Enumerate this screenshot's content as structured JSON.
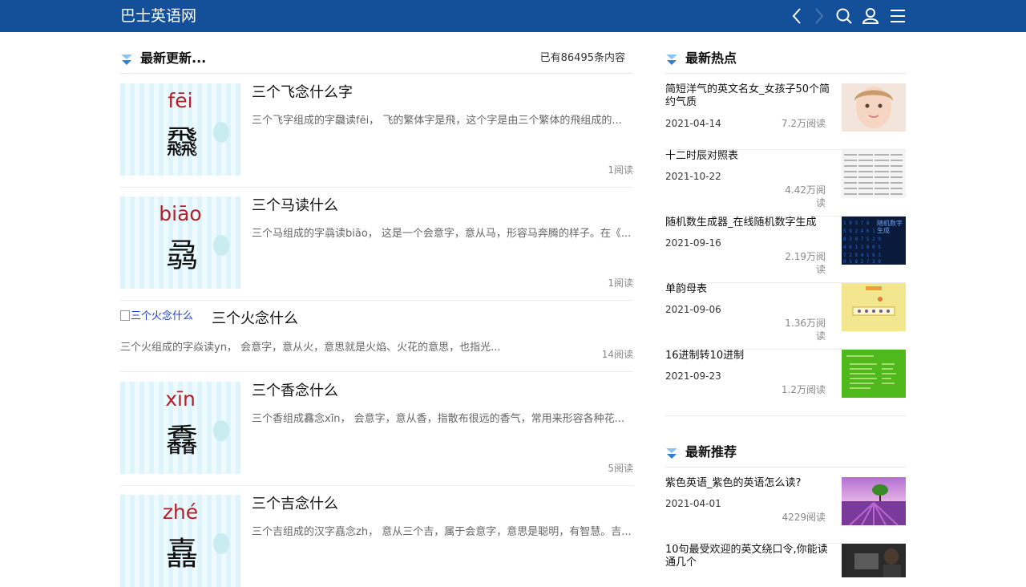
{
  "header": {
    "logo": "巴士英语网",
    "icons": [
      "chevron-left-icon",
      "chevron-right-icon",
      "search-icon",
      "user-icon",
      "menu-icon"
    ],
    "bg_color": "#14509a"
  },
  "latest": {
    "title": "最新更新...",
    "count": "已有86495条内容",
    "articles": [
      {
        "title": "三个飞念什么字",
        "desc": "三个飞字组成的字飝读fēi， 飞的繁体字是飛，这个字是由三个繁体的飛组成的...",
        "reads": "1阅读",
        "pinyin": "fēi",
        "glyph": "飝"
      },
      {
        "title": "三个马读什么",
        "desc": "三个马组成的字骉读biāo， 这是一个会意字，意从马，形容马奔腾的样子。在《...",
        "reads": "1阅读",
        "pinyin": "biāo",
        "glyph": "骉"
      },
      {
        "title": "三个火念什么",
        "desc": "三个火组成的字焱读yn， 会意字，意从火，意思就是火焰、火花的意思，也指光...",
        "reads": "14阅读",
        "alt": "三个火念什么"
      },
      {
        "title": "三个香念什么",
        "desc": "三个香组成馫念xīn， 会意字，意从香，指散布很远的香气，常用来形容各种花...",
        "reads": "5阅读",
        "pinyin": "xīn",
        "glyph": "馫"
      },
      {
        "title": "三个吉念什么",
        "desc": "三个吉组成的汉字嚞念zh， 意从三个吉，属于会意字，意思是聪明，有智慧。吉...",
        "reads": "",
        "pinyin": "zhé",
        "glyph": "嚞"
      }
    ]
  },
  "hot": {
    "title": "最新热点",
    "items": [
      {
        "title": "简短洋气的英文名女_女孩子50个简约气质",
        "date": "2021-04-14",
        "reads": "7.2万阅读"
      },
      {
        "title": "十二时辰对照表",
        "date": "2021-10-22",
        "reads": "4.42万阅读"
      },
      {
        "title": "随机数生成器_在线随机数字生成",
        "date": "2021-09-16",
        "reads": "2.19万阅读",
        "img_text": "随机数字\n生成"
      },
      {
        "title": "单韵母表",
        "date": "2021-09-06",
        "reads": "1.36万阅读"
      },
      {
        "title": "16进制转10进制",
        "date": "2021-09-23",
        "reads": "1.2万阅读"
      }
    ]
  },
  "recommend": {
    "title": "最新推荐",
    "items": [
      {
        "title": "紫色英语_紫色的英语怎么读?",
        "date": "2021-04-01",
        "reads": "4229阅读"
      },
      {
        "title": "10句最受欢迎的英文绕口令,你能读通几个",
        "date": "",
        "reads": ""
      }
    ]
  }
}
